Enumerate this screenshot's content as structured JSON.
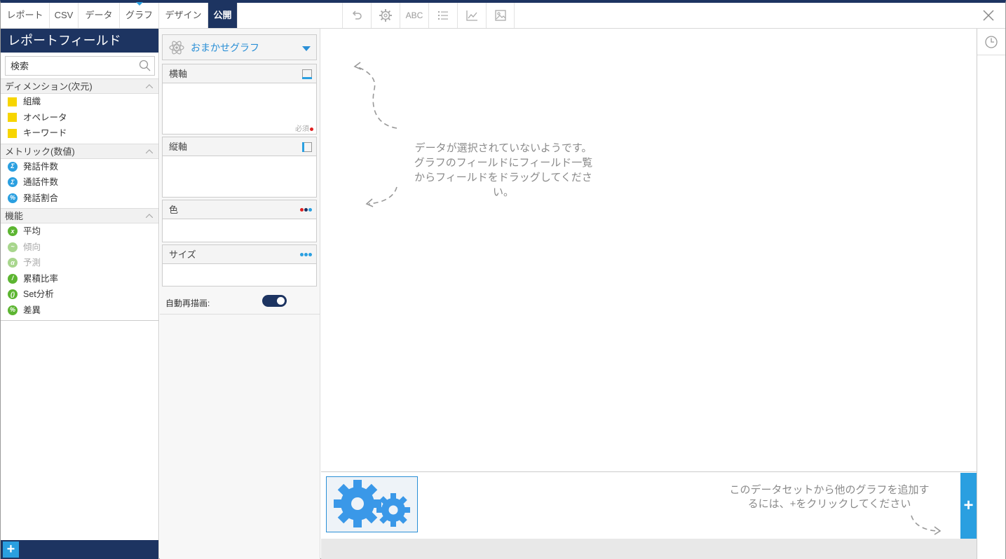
{
  "tabs": [
    {
      "label": "レポート"
    },
    {
      "label": "CSV"
    },
    {
      "label": "データ"
    },
    {
      "label": "グラフ"
    },
    {
      "label": "デザイン"
    },
    {
      "label": "公開"
    }
  ],
  "toolbar": {
    "abc_label": "ABC"
  },
  "left_panel": {
    "title": "レポートフィールド",
    "search_placeholder": "検索",
    "dimensions": {
      "header": "ディメンション(次元)",
      "items": [
        "組織",
        "オペレータ",
        "キーワード"
      ]
    },
    "metrics": {
      "header": "メトリック(数値)",
      "items": [
        {
          "label": "発話件数",
          "icon": "Σ"
        },
        {
          "label": "通話件数",
          "icon": "Σ"
        },
        {
          "label": "発話割合",
          "icon": "%"
        }
      ]
    },
    "functions": {
      "header": "機能",
      "items": [
        {
          "label": "平均",
          "icon": "x"
        },
        {
          "label": "傾向",
          "icon": "~"
        },
        {
          "label": "予測",
          "icon": "α"
        },
        {
          "label": "累積比率",
          "icon": "/"
        },
        {
          "label": "Set分析",
          "icon": "()"
        },
        {
          "label": "差異",
          "icon": "%"
        }
      ]
    },
    "add_label": "+"
  },
  "middle_panel": {
    "chart_type": "おまかせグラフ",
    "shelves": {
      "x_axis": "横軸",
      "required": "必須",
      "y_axis": "縦軸",
      "color": "色",
      "size": "サイズ"
    },
    "auto_redraw_label": "自動再描画:"
  },
  "canvas": {
    "empty_message_1": "データが選択されていないようです。",
    "empty_message_2": "グラフのフィールドにフィールド一覧",
    "empty_message_3": "からフィールドをドラッグしてくださ",
    "empty_message_4": "い。"
  },
  "thumbstrip": {
    "add_message_1": "このデータセットから他のグラフを追加す",
    "add_message_2": "るには、+をクリックしてください",
    "add_label": "+"
  },
  "colors": {
    "navy": "#1d3461",
    "accent_blue": "#2a9fe0",
    "field_yellow": "#f7d500",
    "function_green": "#5cb531"
  }
}
